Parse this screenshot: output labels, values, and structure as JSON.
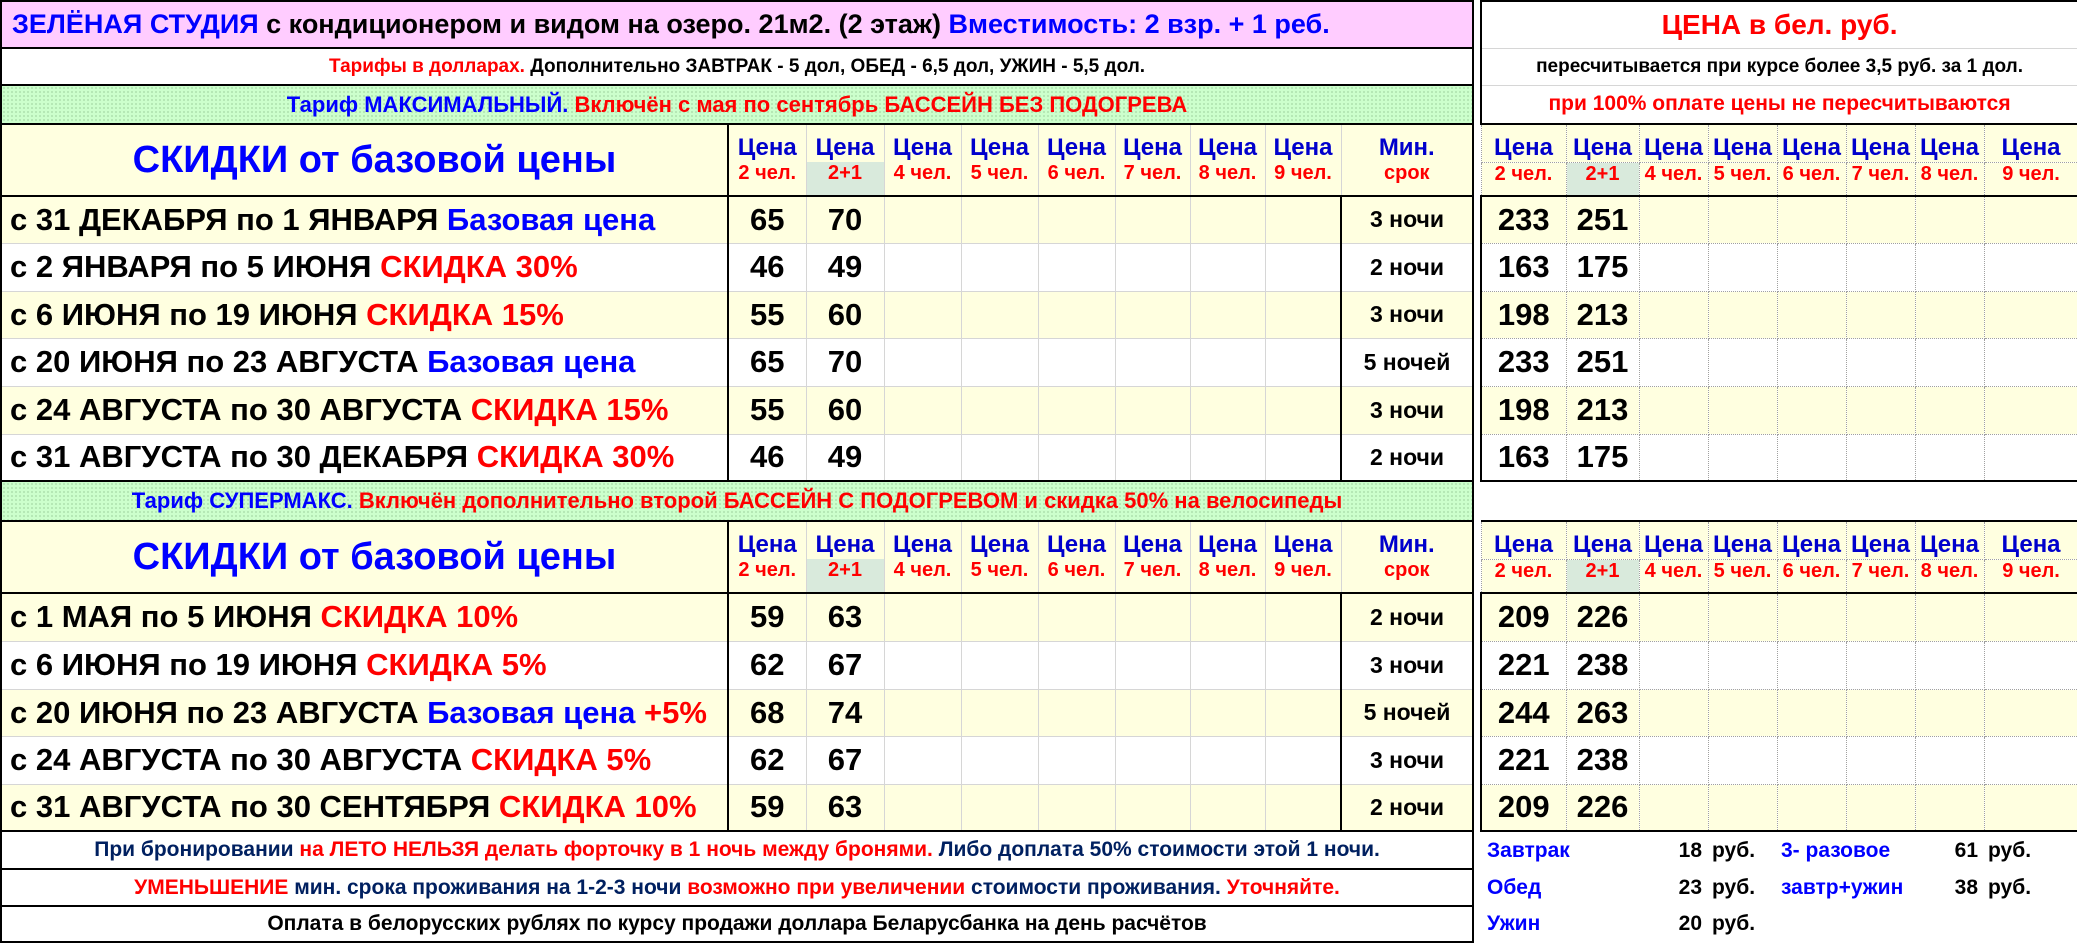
{
  "title": {
    "green_studio": "ЗЕЛЁНАЯ СТУДИЯ",
    "rest": " с кондиционером и видом на озеро. 21м2. (2 этаж) ",
    "capacity": "Вместимость: 2 взр. + 1 реб."
  },
  "tariffs_line": {
    "red": "Тарифы в долларах.",
    "black": " Дополнительно ЗАВТРАК - 5 дол, ОБЕД - 6,5 дол, УЖИН - 5,5 дол."
  },
  "tariff_max": {
    "blue": "Тариф МАКСИМАЛЬНЫЙ.",
    "red": " Включён с мая по сентябрь БАССЕЙН БЕЗ ПОДОГРЕВА"
  },
  "tariff_super": {
    "blue": "Тариф СУПЕРМАКС.",
    "red": " Включён дополнительно второй БАССЕЙН С ПОДОГРЕВОМ и скидка 50% на велосипеды"
  },
  "discounts_heading": "СКИДКИ от базовой цены",
  "col_top": [
    "Цена",
    "Цена",
    "Цена",
    "Цена",
    "Цена",
    "Цена",
    "Цена",
    "Цена",
    "Мин."
  ],
  "col_bot": [
    "2 чел.",
    "2+1",
    "4 чел.",
    "5 чел.",
    "6 чел.",
    "7 чел.",
    "8 чел.",
    "9 чел.",
    "срок"
  ],
  "rcol_top": [
    "Цена",
    "Цена",
    "Цена",
    "Цена",
    "Цена",
    "Цена",
    "Цена",
    "Цена"
  ],
  "rcol_bot": [
    "2 чел.",
    "2+1",
    "4 чел.",
    "5 чел.",
    "6 чел.",
    "7 чел.",
    "8 чел.",
    "9 чел."
  ],
  "section1_rows": [
    {
      "label": "с 31 ДЕКАБРЯ по 1 ЯНВАРЯ ",
      "tag": "Базовая цена",
      "tag_color": "blue",
      "tag_extra": "",
      "usd2": "65",
      "usd3": "70",
      "nights": "3 ночи",
      "byn2": "233",
      "byn3": "251"
    },
    {
      "label": "с 2 ЯНВАРЯ по 5 ИЮНЯ ",
      "tag": "СКИДКА 30%",
      "tag_color": "red",
      "tag_extra": "",
      "usd2": "46",
      "usd3": "49",
      "nights": "2 ночи",
      "byn2": "163",
      "byn3": "175"
    },
    {
      "label": "с 6 ИЮНЯ по 19 ИЮНЯ ",
      "tag": "СКИДКА 15%",
      "tag_color": "red",
      "tag_extra": "",
      "usd2": "55",
      "usd3": "60",
      "nights": "3 ночи",
      "byn2": "198",
      "byn3": "213"
    },
    {
      "label": "с 20 ИЮНЯ по 23 АВГУСТА ",
      "tag": "Базовая цена",
      "tag_color": "blue",
      "tag_extra": "",
      "usd2": "65",
      "usd3": "70",
      "nights": "5 ночей",
      "byn2": "233",
      "byn3": "251"
    },
    {
      "label": "с 24 АВГУСТА по 30 АВГУСТА ",
      "tag": "СКИДКА 15%",
      "tag_color": "red",
      "tag_extra": "",
      "usd2": "55",
      "usd3": "60",
      "nights": "3 ночи",
      "byn2": "198",
      "byn3": "213"
    },
    {
      "label": "с 31 АВГУСТА по 30 ДЕКАБРЯ  ",
      "tag": "СКИДКА 30%",
      "tag_color": "red",
      "tag_extra": "",
      "usd2": "46",
      "usd3": "49",
      "nights": "2 ночи",
      "byn2": "163",
      "byn3": "175"
    }
  ],
  "section2_rows": [
    {
      "label": "с 1 МАЯ по 5 ИЮНЯ ",
      "tag": "СКИДКА 10%",
      "tag_color": "red",
      "tag_extra": "",
      "usd2": "59",
      "usd3": "63",
      "nights": "2 ночи",
      "byn2": "209",
      "byn3": "226"
    },
    {
      "label": "с 6 ИЮНЯ по 19 ИЮНЯ ",
      "tag": "СКИДКА 5%",
      "tag_color": "red",
      "tag_extra": "",
      "usd2": "62",
      "usd3": "67",
      "nights": "3 ночи",
      "byn2": "221",
      "byn3": "238"
    },
    {
      "label": "с 20 ИЮНЯ по 23 АВГУСТА ",
      "tag": "Базовая цена",
      "tag_color": "blue",
      "tag_extra": " +5%",
      "usd2": "68",
      "usd3": "74",
      "nights": "5 ночей",
      "byn2": "244",
      "byn3": "263"
    },
    {
      "label": "с 24 АВГУСТА по 30 АВГУСТА ",
      "tag": "СКИДКА 5%",
      "tag_color": "red",
      "tag_extra": "",
      "usd2": "62",
      "usd3": "67",
      "nights": "3 ночи",
      "byn2": "221",
      "byn3": "238"
    },
    {
      "label": "с 31 АВГУСТА по 30 СЕНТЯБРЯ  ",
      "tag": "СКИДКА 10%",
      "tag_color": "red",
      "tag_extra": "",
      "usd2": "59",
      "usd3": "63",
      "nights": "2 ночи",
      "byn2": "209",
      "byn3": "226"
    }
  ],
  "footer1": {
    "a": "При бронировании ",
    "b": "на ЛЕТО НЕЛЬЗЯ делать форточку в 1 ночь между бронями.",
    "c": " Либо доплата 50% стоимости этой 1 ночи."
  },
  "footer2": {
    "a": "УМЕНЬШЕНИЕ",
    "b": " мин. срока проживания на 1-2-3 ночи ",
    "c": "возможно при увеличении",
    "d": " стоимости проживания. ",
    "e": "Уточняйте."
  },
  "footer3": "Оплата в белорусских рублях по курсу продажи доллара Беларусбанка на день расчётов",
  "price_byn": "ЦЕНА в бел. руб.",
  "recalc": "пересчитывается при курсе более 3,5 руб. за 1 дол.",
  "no_recalc": "при 100% оплате цены не пересчитываются",
  "meals": {
    "breakfast": "Завтрак",
    "breakfast_price": "18",
    "lunch": "Обед",
    "lunch_price": "23",
    "dinner": "Ужин",
    "dinner_price": "20",
    "three": "3- разовое",
    "three_price": "61",
    "bd": "завтр+ужин",
    "bd_price": "38",
    "unit": "руб."
  }
}
